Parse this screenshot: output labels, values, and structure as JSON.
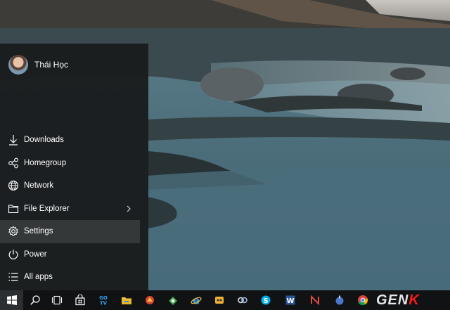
{
  "user": {
    "name": "Thái Học"
  },
  "menu": {
    "items": [
      {
        "label": "Downloads",
        "icon": "download-icon"
      },
      {
        "label": "Homegroup",
        "icon": "homegroup-icon"
      },
      {
        "label": "Network",
        "icon": "network-icon"
      },
      {
        "label": "File Explorer",
        "icon": "folder-icon",
        "has_submenu": true
      },
      {
        "label": "Settings",
        "icon": "gear-icon",
        "highlighted": true
      },
      {
        "label": "Power",
        "icon": "power-icon"
      },
      {
        "label": "All apps",
        "icon": "list-icon"
      }
    ]
  },
  "taskbar": {
    "apps": [
      "start-button",
      "search-icon",
      "task-view-icon",
      "store-icon",
      "gotv-icon",
      "file-explorer-icon",
      "app-red-icon",
      "app-green-icon",
      "internet-explorer-icon",
      "app-yellow-icon",
      "app-link-icon",
      "skype-icon",
      "word-icon",
      "app-n-icon",
      "app-blue-icon",
      "chrome-icon"
    ],
    "gotv_label": "GO TV",
    "watermark_main": "GEN",
    "watermark_accent": "K"
  },
  "colors": {
    "menu_bg": "#1a1c1d",
    "highlight": "#353839",
    "taskbar_bg": "#101214",
    "watermark_accent": "#ff1a1a"
  }
}
